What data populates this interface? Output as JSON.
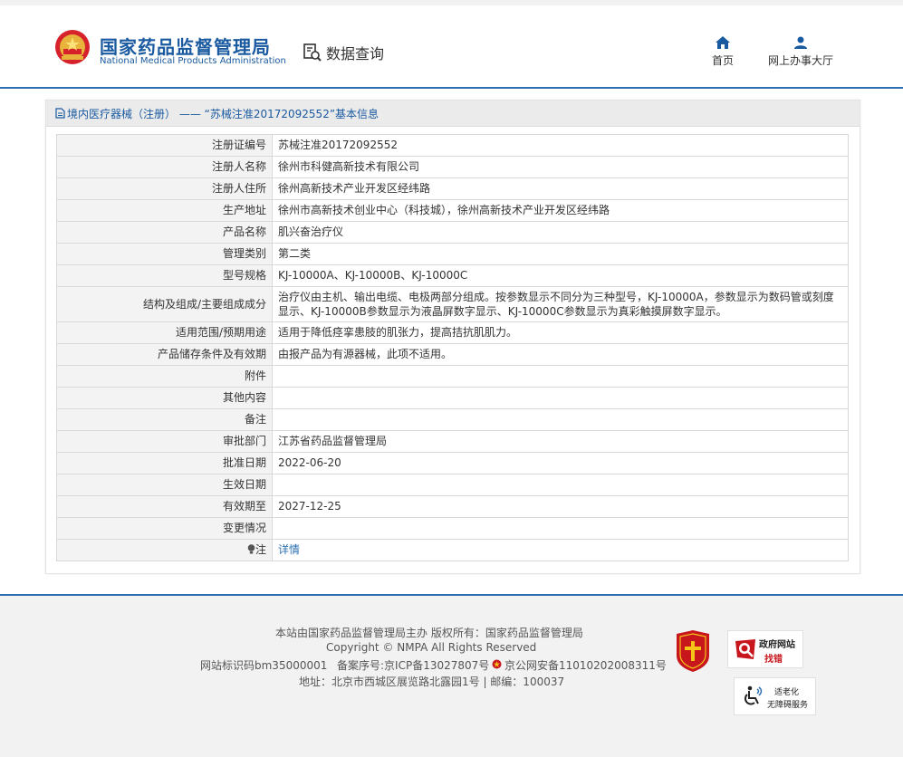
{
  "header": {
    "site_name_cn": "国家药品监督管理局",
    "site_name_en": "National Medical Products Administration",
    "query_label": "数据查询",
    "nav": [
      {
        "label": "首页",
        "icon": "home-icon"
      },
      {
        "label": "网上办事大厅",
        "icon": "user-icon"
      }
    ]
  },
  "panel": {
    "title": "境内医疗器械（注册） —— “苏械注准20172092552”基本信息",
    "rows": [
      {
        "key": "注册证编号",
        "value": "苏械注准20172092552"
      },
      {
        "key": "注册人名称",
        "value": "徐州市科健高新技术有限公司"
      },
      {
        "key": "注册人住所",
        "value": "徐州高新技术产业开发区经纬路"
      },
      {
        "key": "生产地址",
        "value": "徐州市高新技术创业中心（科技城），徐州高新技术产业开发区经纬路"
      },
      {
        "key": "产品名称",
        "value": "肌兴奋治疗仪"
      },
      {
        "key": "管理类别",
        "value": "第二类"
      },
      {
        "key": "型号规格",
        "value": "KJ-10000A、KJ-10000B、KJ-10000C"
      },
      {
        "key": "结构及组成/主要组成成分",
        "value": "治疗仪由主机、输出电缆、电极两部分组成。按参数显示不同分为三种型号，KJ-10000A，参数显示为数码管或刻度显示、KJ-10000B参数显示为液晶屏数字显示、KJ-10000C参数显示为真彩触摸屏数字显示。"
      },
      {
        "key": "适用范围/预期用途",
        "value": "适用于降低痉挛患肢的肌张力，提高拮抗肌肌力。"
      },
      {
        "key": "产品储存条件及有效期",
        "value": "由报产品为有源器械，此项不适用。"
      },
      {
        "key": "附件",
        "value": ""
      },
      {
        "key": "其他内容",
        "value": ""
      },
      {
        "key": "备注",
        "value": ""
      },
      {
        "key": "审批部门",
        "value": "江苏省药品监督管理局"
      },
      {
        "key": "批准日期",
        "value": "2022-06-20"
      },
      {
        "key": "生效日期",
        "value": ""
      },
      {
        "key": "有效期至",
        "value": "2027-12-25"
      },
      {
        "key": "变更情况",
        "value": ""
      }
    ],
    "note_key": "注",
    "note_link": "详情"
  },
  "footer": {
    "line1": "本站由国家药品监督管理局主办 版权所有：国家药品监督管理局",
    "line2": "Copyright © NMPA All Rights Reserved",
    "site_id": "网站标识码bm35000001",
    "icp": "备案序号:京ICP备13027807号",
    "police": "京公网安备11010202008311号",
    "address": "地址：北京市西城区展览路北露园1号 | 邮编：100037",
    "gov_badge_line1": "政府网站",
    "gov_badge_line2": "找错",
    "age_badge_line1": "适老化",
    "age_badge_line2": "无障碍服务"
  }
}
